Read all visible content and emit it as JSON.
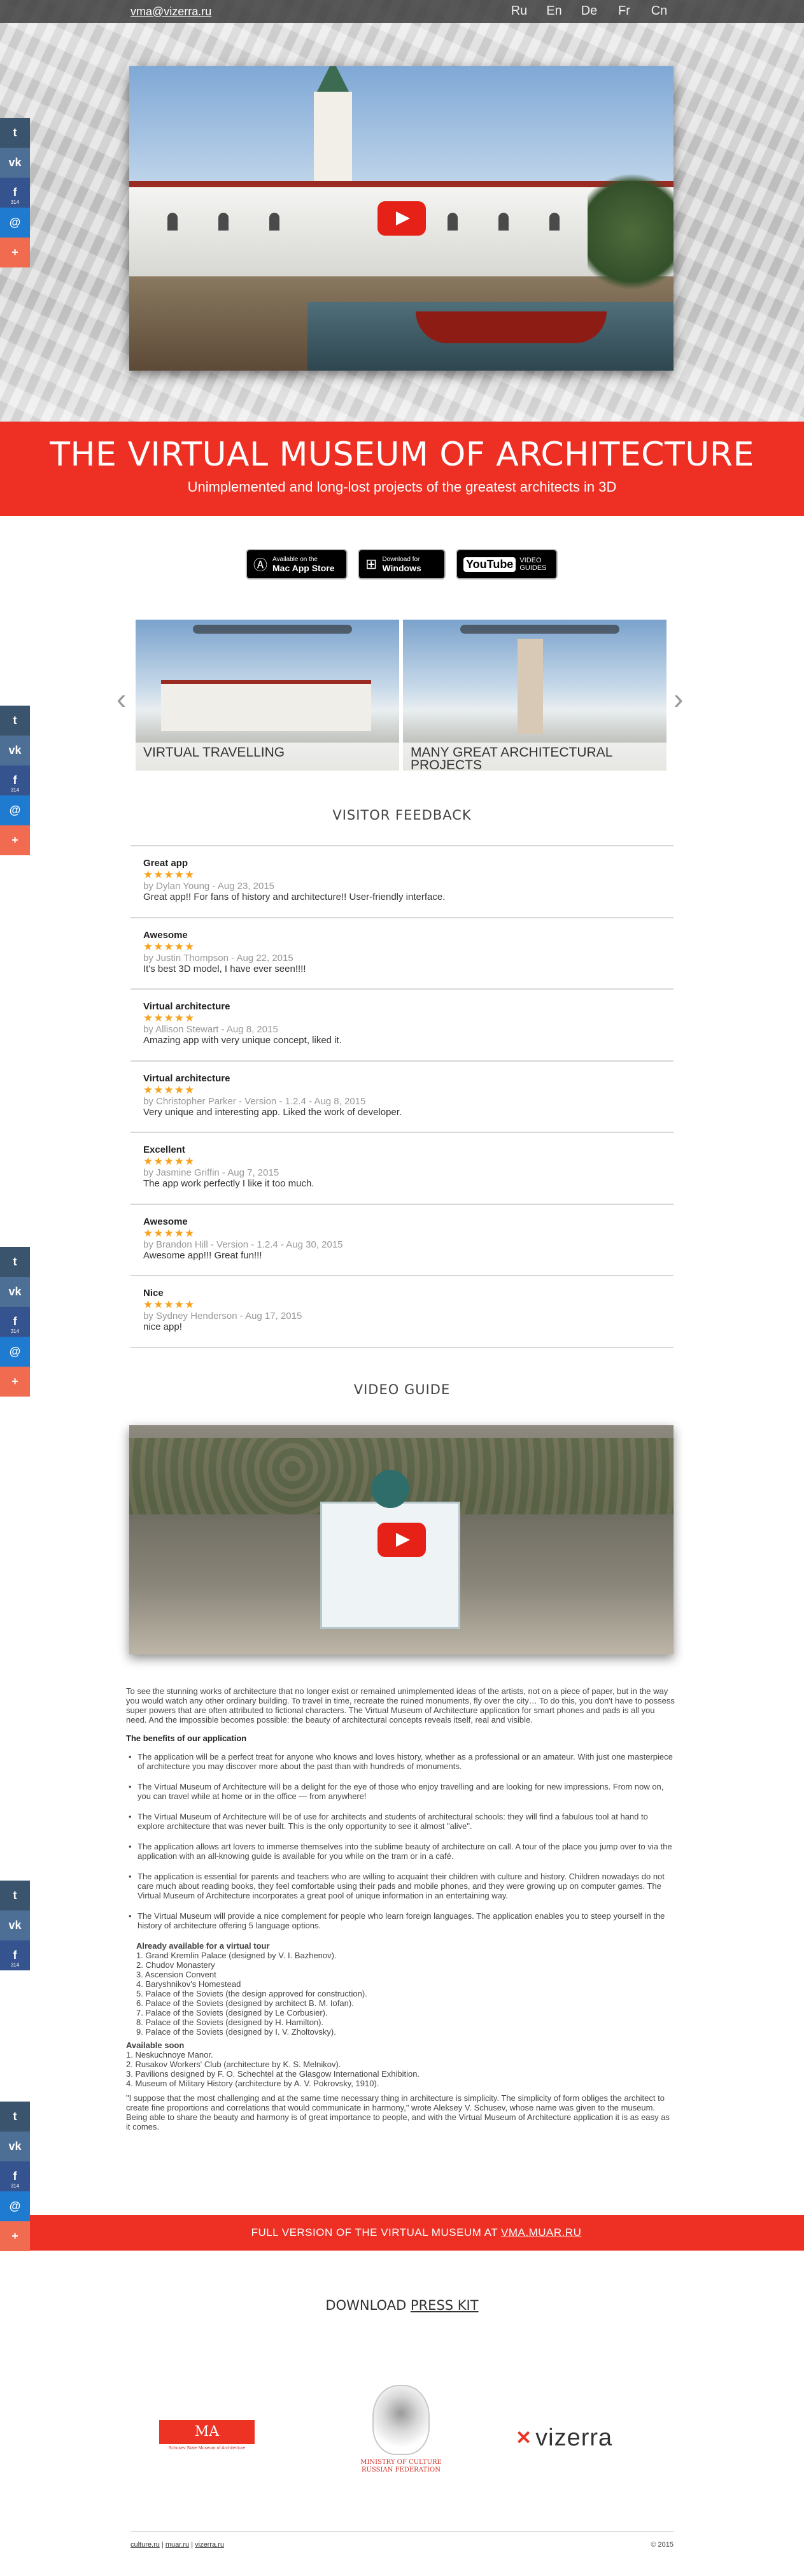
{
  "topbar": {
    "email": "vma@vizerra.ru",
    "languages": [
      "Ru",
      "En",
      "De",
      "Fr",
      "Cn"
    ]
  },
  "banner": {
    "title": "THE VIRTUAL MUSEUM OF ARCHITECTURE",
    "subtitle": "Unimplemented and long-lost projects of the greatest architects in 3D"
  },
  "stores": {
    "mac": {
      "small": "Available on the",
      "big": "Mac App Store"
    },
    "windows": {
      "small": "Download for",
      "big": "Windows"
    },
    "youtube": {
      "logo": "YouTube",
      "small": "VIDEO GUIDES"
    }
  },
  "gallery": {
    "items": [
      "VIRTUAL TRAVELLING",
      "MANY GREAT ARCHITECTURAL PROJECTS"
    ]
  },
  "social": {
    "facebook_count": "314",
    "icons": [
      "tumblr-icon",
      "vk-icon",
      "facebook-icon",
      "mail-icon",
      "plus-icon"
    ]
  },
  "feedback": {
    "heading": "VISITOR FEEDBACK",
    "stars": "★★★★★",
    "items": [
      {
        "title": "Great app",
        "by": "by Dylan Young - Aug 23, 2015",
        "text": "Great app!! For fans of history and architecture!! User-friendly interface."
      },
      {
        "title": "Awesome",
        "by": "by Justin Thompson - Aug 22, 2015",
        "text": "It's best 3D model, I have ever seen!!!!"
      },
      {
        "title": "Virtual architecture",
        "by": "by Allison Stewart - Aug 8, 2015",
        "text": "Amazing app with very unique concept, liked it."
      },
      {
        "title": "Virtual architecture",
        "by": "by Christopher Parker - Version - 1.2.4 - Aug 8, 2015",
        "text": "Very unique and interesting app. Liked the work of developer."
      },
      {
        "title": "Excellent",
        "by": "by Jasmine Griffin - Aug 7, 2015",
        "text": "The app work perfectly I like it too much."
      },
      {
        "title": "Awesome",
        "by": "by Brandon Hill - Version - 1.2.4 - Aug 30, 2015",
        "text": "Awesome app!!! Great fun!!!"
      },
      {
        "title": "Nice",
        "by": "by Sydney Henderson - Aug 17, 2015",
        "text": "nice app!"
      }
    ]
  },
  "video_guide": {
    "heading": "VIDEO GUIDE"
  },
  "text": {
    "lead": "To see the stunning works of architecture that no longer exist or remained unimplemented ideas of the artists, not on a piece of paper, but in the way you would watch any other ordinary building. To travel in time, recreate the ruined monuments, fly over the city… To do this, you don't have to possess super powers that are often attributed to fictional characters. The Virtual Museum of Architecture application for smart phones and pads is all you need. And the impossible becomes possible: the beauty of architectural concepts reveals itself, real and visible.",
    "benefits_heading": "The benefits of our application",
    "benefits": [
      "The application will be a perfect treat for anyone who knows and loves history, whether as a professional or an amateur. With just one masterpiece of architecture you may discover more about the past than with hundreds of monuments.",
      "The Virtual Museum of Architecture will be a delight for the eye of those who enjoy travelling and are looking for new impressions. From now on, you can travel while at home or in the office — from anywhere!",
      "The Virtual Museum of Architecture will be of use for architects and students of architectural schools: they will find a fabulous tool at hand to explore architecture that was never built. This is the only opportunity to see it almost \"alive\".",
      "The application allows art lovers to immerse themselves into the sublime beauty of architecture on call. A tour of the place you jump over to via the application with an all-knowing guide is available for you while on the tram or in a café.",
      "The application is essential for parents and teachers who are willing to acquaint their children with culture and history. Children nowadays do not care much about reading books, they feel comfortable using their pads and mobile phones, and they were growing up on computer games. The Virtual Museum of Architecture incorporates a great pool of unique information in an entertaining way.",
      "The Virtual Museum will provide a nice complement for people who learn foreign languages. The application enables you to steep yourself in the history of architecture offering 5 language options."
    ],
    "available_heading": "Already available for a virtual tour",
    "available": [
      "1. Grand Kremlin Palace (designed by V. I. Bazhenov).",
      "2. Chudov Monastery",
      "3. Ascension Convent",
      "4. Baryshnikov's Homestead",
      "5. Palace of the Soviets (the design approved for construction).",
      "6. Palace of the Soviets (designed by architect B. M. Iofan).",
      "7. Palace of the Soviets (designed by Le Corbusier).",
      "8. Palace of the Soviets (designed by H. Hamilton).",
      "9. Palace of the Soviets (designed by I. V. Zholtovsky)."
    ],
    "soon_heading": "Available soon",
    "soon": [
      "1. Neskuchnoye Manor.",
      "2. Rusakov Workers' Club (architecture by K. S. Melnikov).",
      "3. Pavilions designed by F. O. Schechtel at the Glasgow International Exhibition.",
      "4. Museum of Military History (architecture by A. V. Pokrovsky, 1910)."
    ],
    "quote": "\"I suppose that the most challenging and at the same time necessary thing in architecture is simplicity. The simplicity of form obliges the architect to create fine proportions and correlations that would communicate in harmony,\" wrote Aleksey V. Schusev, whose name was given to the museum. Being able to share the beauty and harmony is of great importance to people, and with the Virtual Museum of Architecture application it is as easy as it comes."
  },
  "fullbar": {
    "text": "FULL VERSION OF THE VIRTUAL MUSEUM AT ",
    "link": "VMA.MUAR.RU"
  },
  "presskit": {
    "prefix": "DOWNLOAD ",
    "link": "PRESS KIT"
  },
  "logos": {
    "ma": {
      "mark": "MA",
      "caption": "Schusev State Museum of Architecture"
    },
    "ministry": {
      "caption_line1": "MINISTRY OF CULTURE",
      "caption_line2": "RUSSIAN FEDERATION"
    },
    "vizerra": {
      "mark": "✕",
      "text": "vizerra"
    }
  },
  "footer": {
    "links": [
      "culture.ru",
      "muar.ru",
      "vizerra.ru"
    ],
    "separator": "|",
    "copyright": "© 2015"
  },
  "colors": {
    "accent": "#ee2f23",
    "star": "#f6a21c"
  }
}
